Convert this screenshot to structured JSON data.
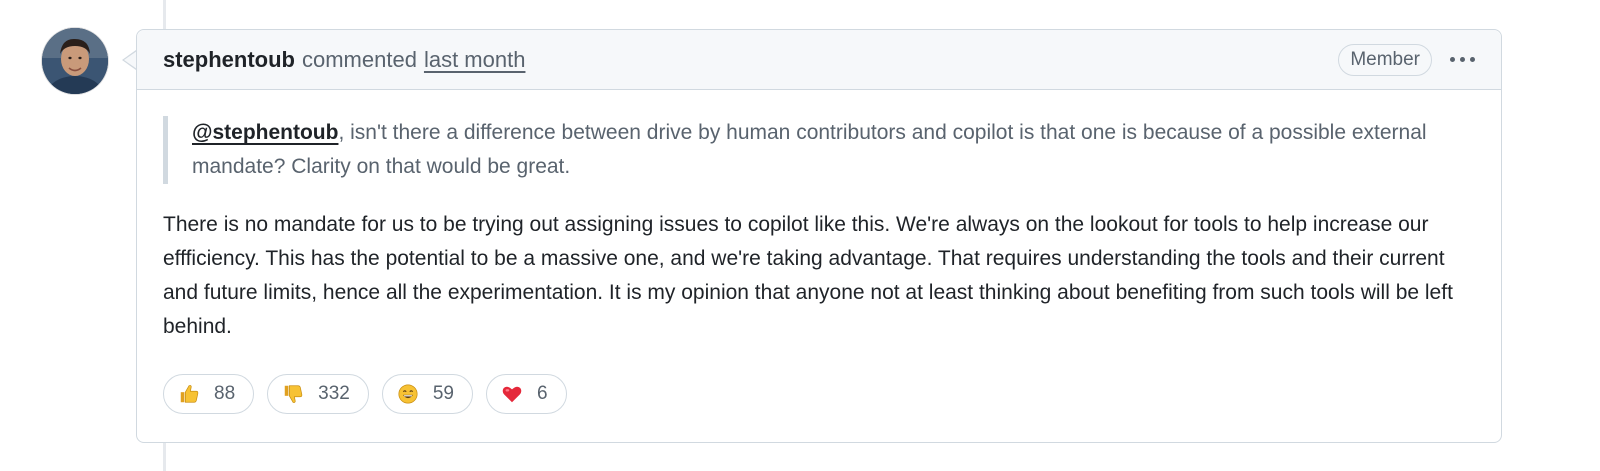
{
  "comment": {
    "author": "stephentoub",
    "action": "commented",
    "timestamp": "last month",
    "badge": "Member",
    "quote": {
      "mention": "@stephentoub",
      "text": ", isn't there a difference between drive by human contributors and copilot is that one is because of a possible external mandate? Clarity on that would be great."
    },
    "body": "There is no mandate for us to be trying out assigning issues to copilot like this. We're always on the lookout for tools to help increase our effficiency. This has the potential to be a massive one, and we're taking advantage. That requires understanding the tools and their current and future limits, hence all the experimentation. It is my opinion that anyone not at least thinking about benefiting from such tools will be left behind."
  },
  "reactions": [
    {
      "icon": "thumbs-up-icon",
      "count": "88"
    },
    {
      "icon": "thumbs-down-icon",
      "count": "332"
    },
    {
      "icon": "laugh-icon",
      "count": "59"
    },
    {
      "icon": "heart-icon",
      "count": "6"
    }
  ],
  "colors": {
    "header_bg": "#f6f8fa",
    "border": "#d1d9e0",
    "text": "#1f2328",
    "muted": "#59636e"
  }
}
